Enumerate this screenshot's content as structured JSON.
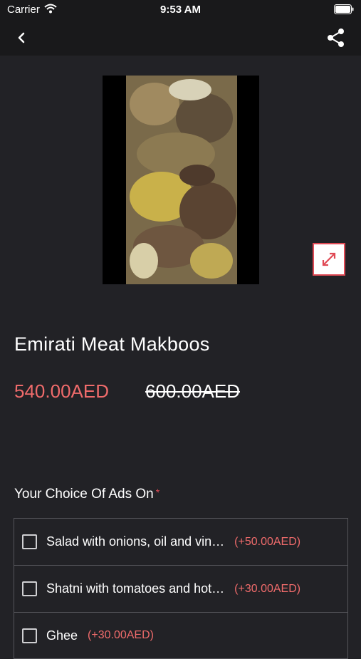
{
  "status_bar": {
    "carrier": "Carrier",
    "time": "9:53 AM"
  },
  "product": {
    "title": "Emirati Meat Makboos",
    "price_current": "540.00AED",
    "price_old": "600.00AED"
  },
  "addons": {
    "title": "Your Choice Of Ads On",
    "required_mark": "*",
    "options": [
      {
        "label": "Salad with onions, oil and vin…",
        "price": "(+50.00AED)"
      },
      {
        "label": "Shatni with tomatoes and hot…",
        "price": "(+30.00AED)"
      },
      {
        "label": "Ghee",
        "price": "(+30.00AED)"
      }
    ]
  },
  "colors": {
    "accent": "#ef6b6b",
    "background": "#222226",
    "bar": "#19191b"
  },
  "icons": [
    "back-arrow-icon",
    "share-icon",
    "expand-icon",
    "wifi-icon",
    "battery-icon"
  ]
}
